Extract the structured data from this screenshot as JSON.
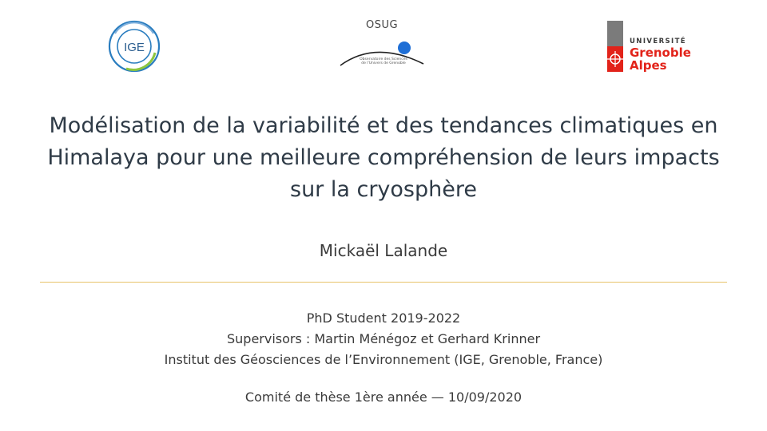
{
  "logos": {
    "ige": {
      "text": "IGE",
      "color_blue": "#2a7dbf",
      "color_green": "#8cc63f"
    },
    "osug": {
      "title": "OSUG",
      "subtitle": "Observatoire des Sciences de l'Univers de Grenoble",
      "color_blue": "#1f6fd6"
    },
    "uga": {
      "line1": "UNIVERSITÉ",
      "line2": "Grenoble",
      "line3": "Alpes",
      "color_red": "#e2231a",
      "color_grey": "#7b7b7b"
    }
  },
  "title": {
    "line1": "Modélisation de la variabilité et des tendances climatiques en",
    "line2": "Himalaya pour une meilleure compréhension de leurs impacts",
    "line3": "sur la cryosphère"
  },
  "author": "Mickaël Lalande",
  "info": {
    "line1": "PhD Student 2019-2022",
    "line2": "Supervisors : Martin Ménégoz et Gerhard Krinner",
    "line3": "Institut des Géosciences de l’Environnement (IGE, Grenoble, France)"
  },
  "footer": "Comité de thèse 1ère année — 10/09/2020",
  "colors": {
    "divider": "#e8c36a",
    "title": "#2f3b47"
  }
}
